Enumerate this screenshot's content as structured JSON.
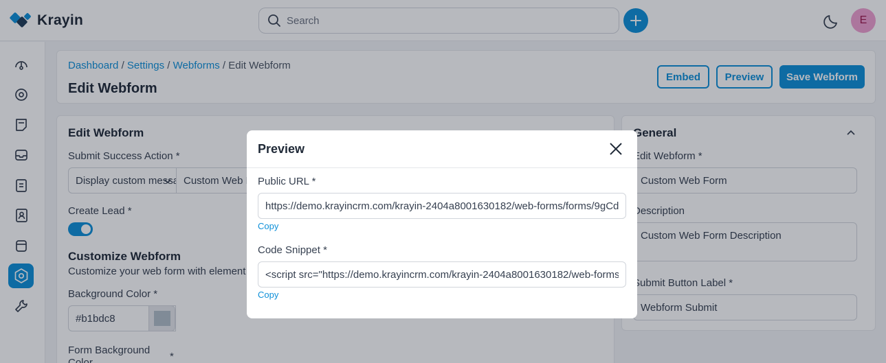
{
  "app": {
    "logo_text": "Krayin"
  },
  "search": {
    "placeholder": "Search"
  },
  "user": {
    "avatar_initial": "E"
  },
  "colors": {
    "accent": "#0e90d9",
    "avatar_bg": "#f0a0d0"
  },
  "sidebar": {
    "items": [
      {
        "icon": "dashboard-icon"
      },
      {
        "icon": "leads-icon"
      },
      {
        "icon": "quotes-icon"
      },
      {
        "icon": "mail-icon"
      },
      {
        "icon": "activities-icon"
      },
      {
        "icon": "contacts-icon"
      },
      {
        "icon": "products-icon"
      },
      {
        "icon": "settings-icon",
        "active": true
      },
      {
        "icon": "configuration-icon"
      }
    ]
  },
  "breadcrumb": {
    "dashboard": "Dashboard",
    "settings": "Settings",
    "webforms": "Webforms",
    "current": "Edit Webform",
    "sep": "/"
  },
  "page": {
    "title": "Edit Webform"
  },
  "header_buttons": {
    "embed": "Embed",
    "preview": "Preview",
    "save": "Save Webform"
  },
  "main_card": {
    "title": "Edit Webform",
    "submit_action_label": "Submit Success Action *",
    "submit_action_value": "Display custom messa",
    "submit_action_text": "Custom Web F",
    "create_lead_label": "Create Lead *",
    "create_lead_enabled": true,
    "customize_title": "Customize Webform",
    "customize_desc": "Customize your web form with element",
    "bg_color_label": "Background Color *",
    "bg_color_value": "#b1bdc8",
    "form_bg_label": "Form Background",
    "form_bg_label_2": "Color",
    "form_bg_required": "*"
  },
  "side_card": {
    "title": "General",
    "name_label": "Edit Webform *",
    "name_value": "Custom Web Form",
    "desc_label": "Description",
    "desc_value": "Custom Web Form Description",
    "submit_label_label": "Submit Button Label *",
    "submit_label_value": "Webform Submit"
  },
  "modal": {
    "title": "Preview",
    "public_url_label": "Public URL *",
    "public_url_value": "https://demo.krayincrm.com/krayin-2404a8001630182/web-forms/forms/9gCd",
    "copy_label": "Copy",
    "code_snippet_label": "Code Snippet *",
    "code_snippet_value": "<script src=\"https://demo.krayincrm.com/krayin-2404a8001630182/web-forms"
  }
}
